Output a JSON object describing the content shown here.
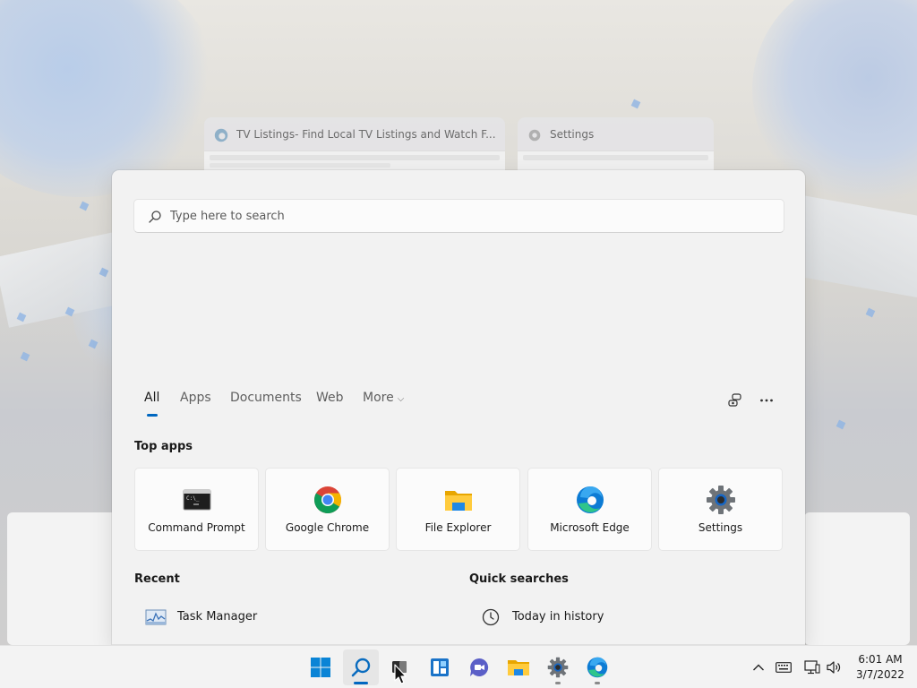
{
  "task_view": {
    "windows": [
      {
        "title": "TV Listings- Find Local TV Listings and Watch F...",
        "icon": "edge-icon"
      },
      {
        "title": "Settings",
        "icon": "gear-icon"
      }
    ]
  },
  "search": {
    "placeholder": "Type here to search",
    "value": ""
  },
  "filters": {
    "tabs": [
      {
        "label": "All",
        "active": true
      },
      {
        "label": "Apps",
        "active": false
      },
      {
        "label": "Documents",
        "active": false
      },
      {
        "label": "Web",
        "active": false
      },
      {
        "label": "More",
        "active": false
      }
    ],
    "accent_color": "#0067c0"
  },
  "top_apps": {
    "title": "Top apps",
    "items": [
      {
        "label": "Command Prompt",
        "icon": "command-prompt-icon"
      },
      {
        "label": "Google Chrome",
        "icon": "chrome-icon"
      },
      {
        "label": "File Explorer",
        "icon": "folder-icon"
      },
      {
        "label": "Microsoft Edge",
        "icon": "edge-icon"
      },
      {
        "label": "Settings",
        "icon": "gear-icon"
      }
    ]
  },
  "recent": {
    "title": "Recent",
    "items": [
      {
        "label": "Task Manager",
        "icon": "task-manager-icon"
      }
    ]
  },
  "quick_searches": {
    "title": "Quick searches",
    "items": [
      {
        "label": "Today in history",
        "icon": "clock-icon"
      }
    ]
  },
  "taskbar": {
    "apps": [
      "start-icon",
      "search-icon",
      "task-view-icon",
      "widgets-icon",
      "chat-icon",
      "file-explorer-icon",
      "settings-icon",
      "edge-icon"
    ],
    "clock": {
      "time": "6:01 AM",
      "date": "3/7/2022"
    }
  }
}
